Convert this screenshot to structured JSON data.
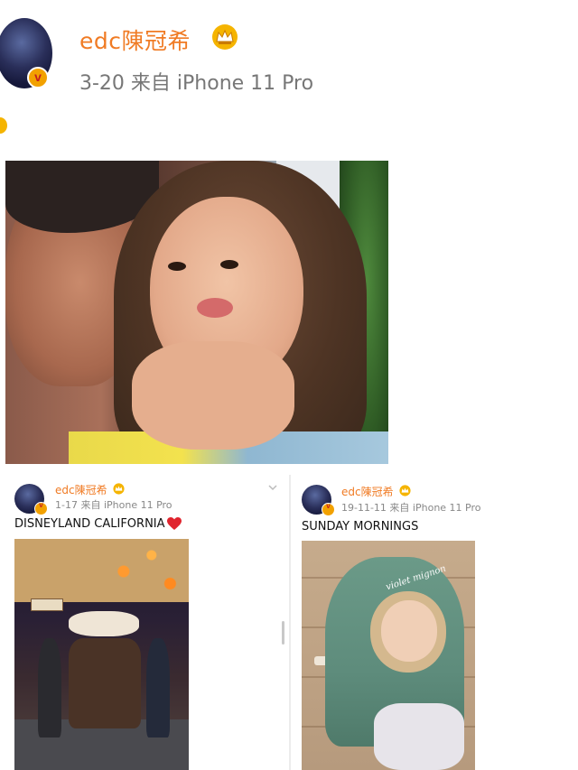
{
  "post": {
    "username": "edc陳冠希",
    "meta": "3-20  来自 iPhone 11 Pro",
    "crown_icon": "crown-icon",
    "verified_icon": "verified-v-icon"
  },
  "embeds": [
    {
      "username": "edc陳冠希",
      "meta": "1-17  来自 iPhone 11 Pro",
      "text": "DISNEYLAND CALIFORNIA",
      "emoji": "red-heart-icon"
    },
    {
      "username": "edc陳冠希",
      "meta": "19-11-11  来自 iPhone 11 Pro",
      "text": "SUNDAY MORNINGS",
      "hood_text": "violet mignon"
    }
  ],
  "colors": {
    "username": "#f07b24",
    "meta": "#777777",
    "badge": "#f2a100"
  }
}
